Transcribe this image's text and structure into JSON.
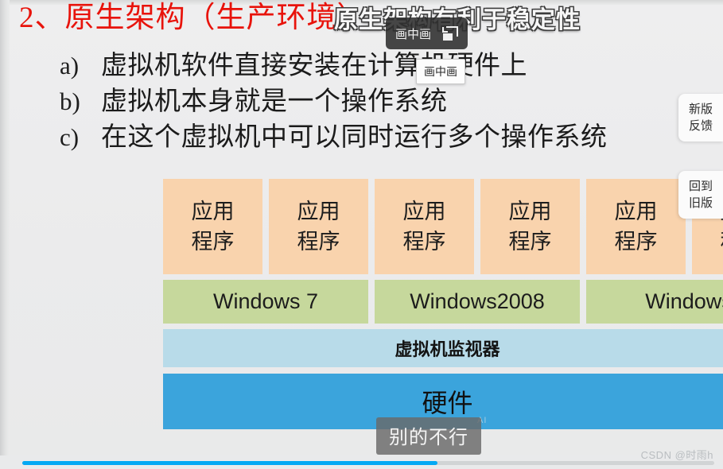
{
  "slide": {
    "headline": "2、原生架构（生产环境）",
    "bullets": [
      {
        "marker": "a)",
        "text": "虚拟机软件直接安装在计算机硬件上"
      },
      {
        "marker": "b)",
        "text": "虚拟机本身就是一个操作系统"
      },
      {
        "marker": "c)",
        "text": "在这个虚拟机中可以同时运行多个操作系统"
      }
    ],
    "diagram": {
      "app_label": "应用程序",
      "app_line1": "应用",
      "app_line2": "程序",
      "app_count": 6,
      "os_boxes": [
        "Windows 7",
        "Windows2008",
        "Windows"
      ],
      "hypervisor": "虚拟机监视器",
      "hardware": "硬件",
      "colors": {
        "app": "#f9d3ad",
        "os": "#c6d89c",
        "hypervisor": "#b8dbe9",
        "hardware": "#3ba4dc"
      }
    }
  },
  "overlays": {
    "subtitle_top": "原生架构有利于稳定性",
    "caption_bottom": "别的不行",
    "ai_watermark": "AI",
    "pip_chip_label": "画中画",
    "pip_tooltip_label": "画中画",
    "pip_icon": "picture-in-picture-icon"
  },
  "side_rail": {
    "feedback": {
      "line1": "新版",
      "line2": "反馈"
    },
    "old_version": {
      "line1": "回到",
      "line2": "旧版"
    }
  },
  "player": {
    "progress_percent": 60,
    "accent_color": "#03a9f4"
  },
  "watermark": {
    "text": "CSDN @时雨h"
  }
}
